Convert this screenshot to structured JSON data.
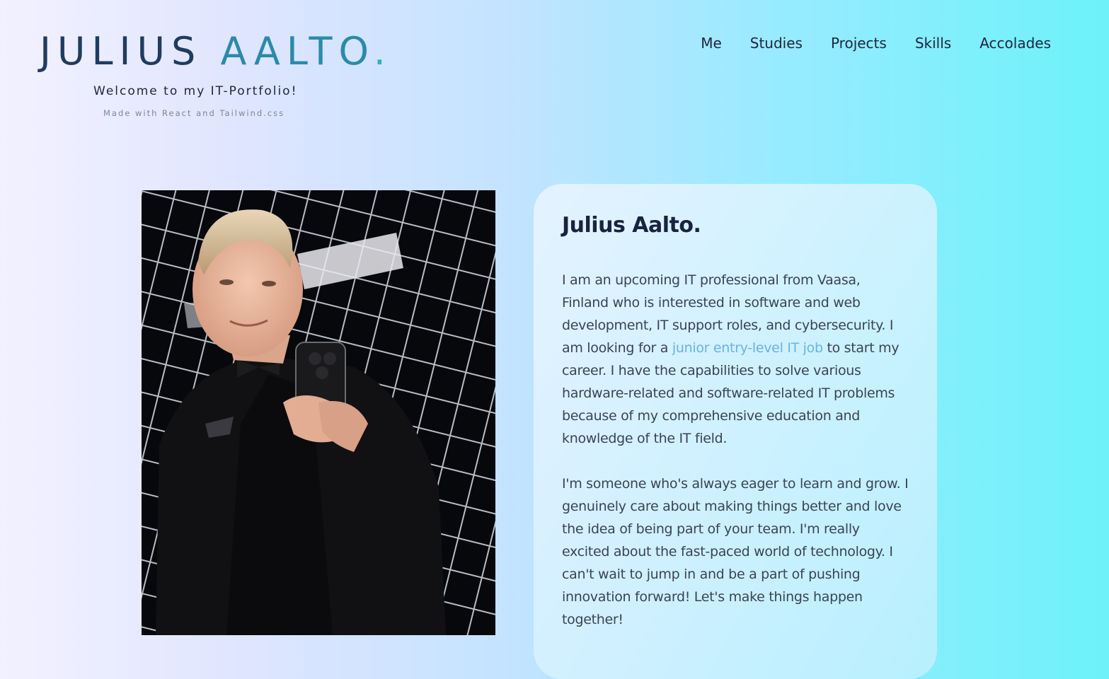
{
  "header": {
    "logo_first": "JULIUS",
    "logo_last": "AALTO",
    "logo_dot": ".",
    "welcome": "Welcome to my IT-Portfolio!",
    "made_with": "Made with React and Tailwind.css"
  },
  "nav": {
    "items": [
      {
        "label": "Me"
      },
      {
        "label": "Studies"
      },
      {
        "label": "Projects"
      },
      {
        "label": "Skills"
      },
      {
        "label": "Accolades"
      }
    ]
  },
  "about": {
    "title": "Julius Aalto.",
    "p1_before": "I am an upcoming IT professional from Vaasa, Finland who is interested in software and web development, IT support roles, and cybersecurity. I am looking for a ",
    "p1_highlight": "junior entry-level IT job",
    "p1_after": " to start my career. I have the capabilities to solve various hardware-related and software-related IT problems because of my comprehensive education and knowledge of the IT field.",
    "p2": "I'm someone who's always eager to learn and grow. I genuinely care about making things better and love the idea of being part of your team. I'm really excited about the fast-paced world of technology. I can't wait to jump in and be a part of pushing innovation forward! Let's make things happen together!"
  },
  "colors": {
    "highlight": "#69b3e6",
    "logo_dark": "#1f3c5e",
    "logo_teal": "#2a8ba8",
    "text": "#3a4358"
  }
}
